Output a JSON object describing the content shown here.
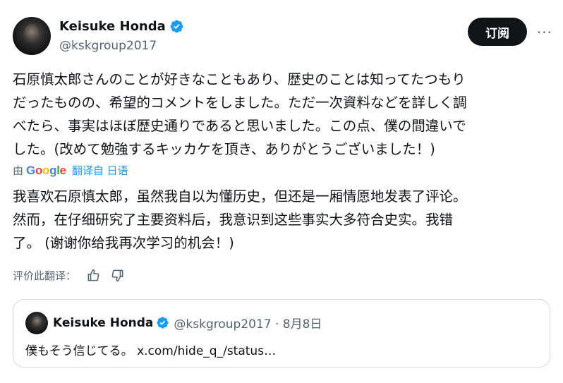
{
  "author": {
    "display_name": "Keisuke Honda",
    "handle": "@kskgroup2017",
    "verified_icon": "verified-badge-icon"
  },
  "actions": {
    "subscribe_label": "订阅",
    "more_label": "···"
  },
  "tweet": {
    "lines": [
      "石原慎太郎さんのことが好きなこともあり、歴史のことは知ってたつもり",
      "だったものの、希望的コメントをしました。ただ一次資料などを詳しく調",
      "べたら、事実はほぼ歴史通りであると思いました。この点、僕の間違いで",
      "した。(改めて勉強するキッカケを頂き、ありがとうございました！)"
    ]
  },
  "translation": {
    "by_label": "由",
    "provider": "Google",
    "link_label": "翻译自 日语",
    "lines": [
      "我喜欢石原慎太郎，虽然我自以为懂历史，但还是一厢情愿地发表了评论。",
      "然而，在仔细研究了主要资料后，我意识到这些事实大多符合史实。我错",
      "了。 (谢谢你给我再次学习的机会！)"
    ],
    "rate_label": "评价此翻译："
  },
  "quoted": {
    "display_name": "Keisuke Honda",
    "meta": "@kskgroup2017 · 8月8日",
    "text": "僕もそう信じてる。 x.com/hide_q_/status…"
  },
  "colors": {
    "accent": "#1d9bf0",
    "text_primary": "#0f1419",
    "text_secondary": "#536471",
    "border": "#cfd9de",
    "button_bg": "#0f1419"
  }
}
